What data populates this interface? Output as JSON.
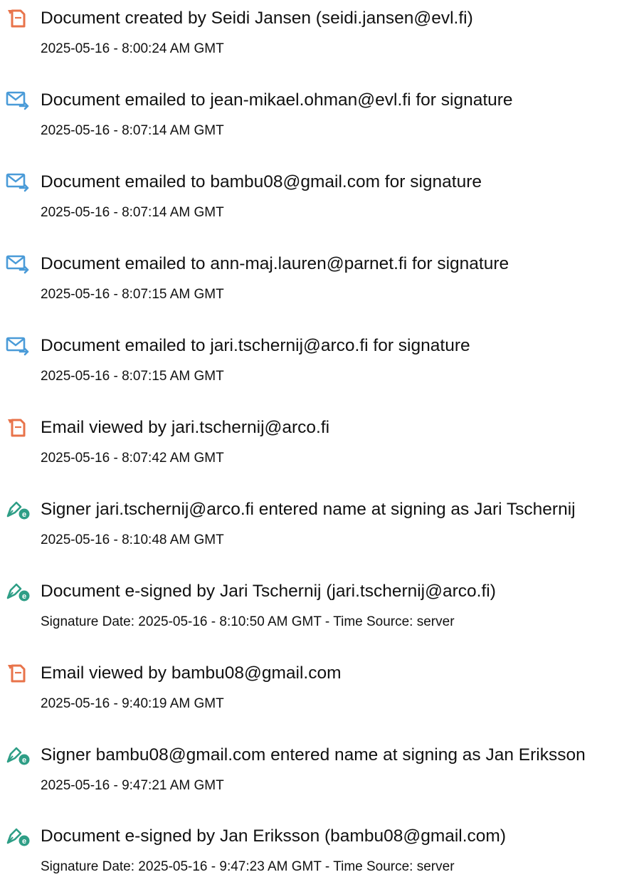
{
  "colors": {
    "text": "#111111",
    "document_icon": "#e8734a",
    "email_icon": "#4a9bd8",
    "sign_icon": "#2e9e86"
  },
  "events": [
    {
      "icon": "document-icon",
      "text": "Document created by Seidi Jansen (seidi.jansen@evl.fi)",
      "date": "2025-05-16 - 8:00:24 AM GMT"
    },
    {
      "icon": "email-sent-icon",
      "text": "Document emailed to jean-mikael.ohman@evl.fi for signature",
      "date": "2025-05-16 - 8:07:14 AM GMT"
    },
    {
      "icon": "email-sent-icon",
      "text": "Document emailed to bambu08@gmail.com for signature",
      "date": "2025-05-16 - 8:07:14 AM GMT"
    },
    {
      "icon": "email-sent-icon",
      "text": "Document emailed to ann-maj.lauren@parnet.fi for signature",
      "date": "2025-05-16 - 8:07:15 AM GMT"
    },
    {
      "icon": "email-sent-icon",
      "text": "Document emailed to jari.tschernij@arco.fi for signature",
      "date": "2025-05-16 - 8:07:15 AM GMT"
    },
    {
      "icon": "document-icon",
      "text": "Email viewed by jari.tschernij@arco.fi",
      "date": "2025-05-16 - 8:07:42 AM GMT"
    },
    {
      "icon": "e-sign-icon",
      "text": "Signer jari.tschernij@arco.fi entered name at signing as Jari Tschernij",
      "date": "2025-05-16 - 8:10:48 AM GMT"
    },
    {
      "icon": "e-sign-icon",
      "text": "Document e-signed by Jari Tschernij (jari.tschernij@arco.fi)",
      "date": "Signature Date: 2025-05-16 - 8:10:50 AM GMT - Time Source: server"
    },
    {
      "icon": "document-icon",
      "text": "Email viewed by bambu08@gmail.com",
      "date": "2025-05-16 - 9:40:19 AM GMT"
    },
    {
      "icon": "e-sign-icon",
      "text": "Signer bambu08@gmail.com entered name at signing as Jan Eriksson",
      "date": "2025-05-16 - 9:47:21 AM GMT"
    },
    {
      "icon": "e-sign-icon",
      "text": "Document e-signed by Jan Eriksson (bambu08@gmail.com)",
      "date": "Signature Date: 2025-05-16 - 9:47:23 AM GMT - Time Source: server"
    }
  ]
}
